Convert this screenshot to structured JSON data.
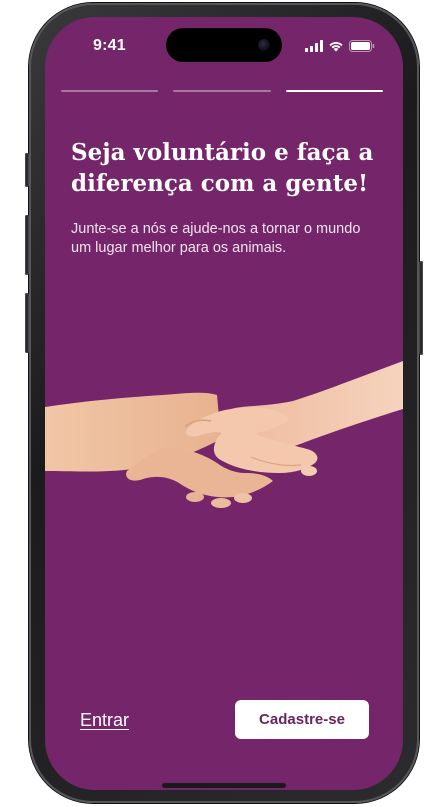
{
  "status_bar": {
    "time": "9:41"
  },
  "onboarding": {
    "step_count": 3,
    "active_step": 3,
    "title": "Seja voluntário e faça a diferença com a gente!",
    "subtitle": "Junte-se a nós e ajude-nos a tornar o mundo um lugar melhor para os animais.",
    "illustration": "handshake-image"
  },
  "actions": {
    "login_label": "Entrar",
    "signup_label": "Cadastre-se"
  },
  "colors": {
    "background": "#75266a",
    "button_bg": "#ffffff",
    "button_text": "#6a2461",
    "text": "#ffffff"
  }
}
